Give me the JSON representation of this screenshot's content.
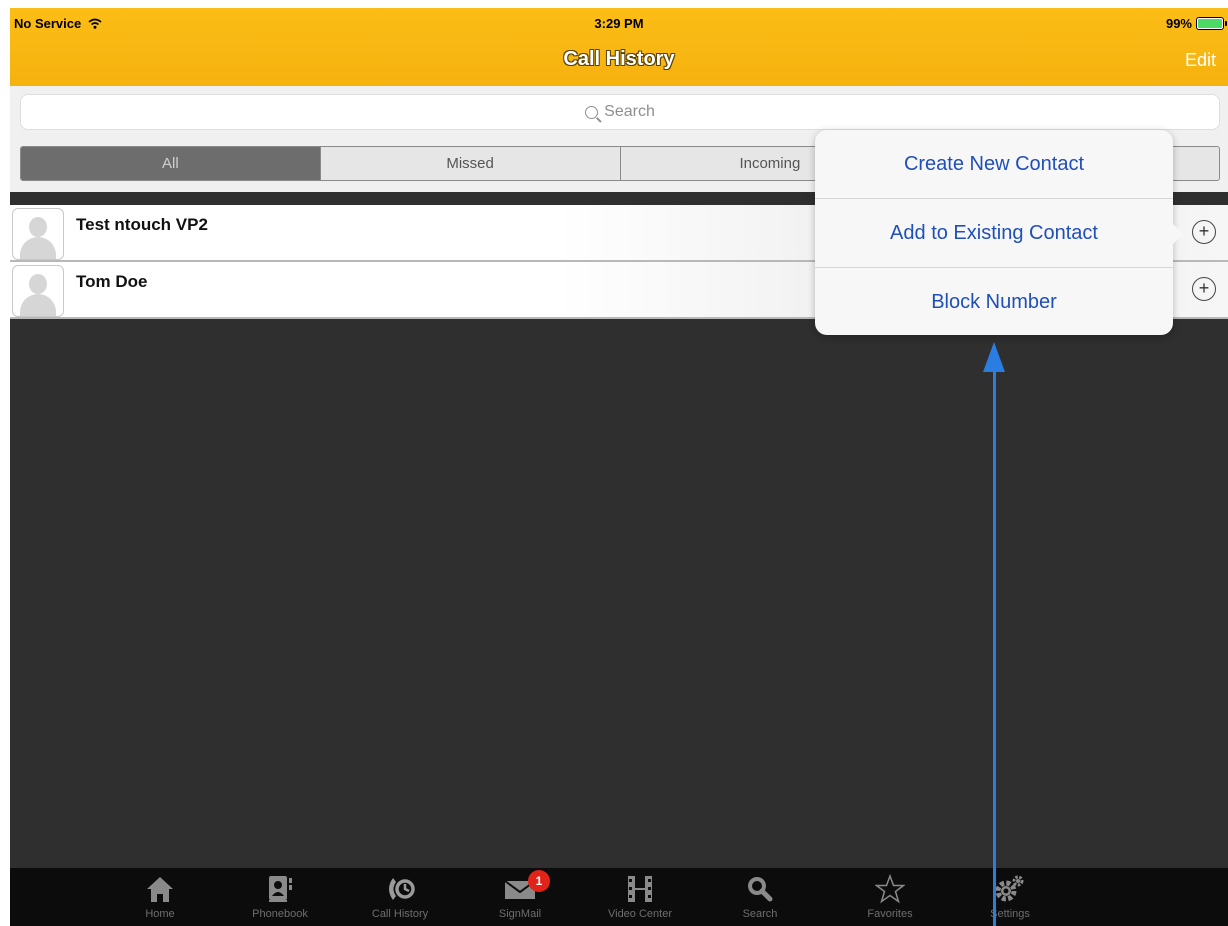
{
  "status_bar": {
    "carrier": "No Service",
    "time": "3:29 PM",
    "battery": "99%"
  },
  "nav_bar": {
    "title": "Call History",
    "edit_label": "Edit"
  },
  "search": {
    "placeholder": "Search"
  },
  "segments": [
    {
      "label": "All",
      "selected": true
    },
    {
      "label": "Missed",
      "selected": false
    },
    {
      "label": "Incoming",
      "selected": false
    },
    {
      "label": "",
      "selected": false
    }
  ],
  "calls": [
    {
      "name": "Test ntouch VP2"
    },
    {
      "name": "Tom Doe"
    }
  ],
  "popover": {
    "items": [
      {
        "label": "Create New Contact"
      },
      {
        "label": "Add to Existing Contact"
      },
      {
        "label": "Block Number"
      }
    ]
  },
  "tab_bar": {
    "tabs": [
      {
        "label": "Home",
        "icon": "home-icon"
      },
      {
        "label": "Phonebook",
        "icon": "phonebook-icon"
      },
      {
        "label": "Call History",
        "icon": "call-history-icon"
      },
      {
        "label": "SignMail",
        "icon": "signmail-icon",
        "badge": "1"
      },
      {
        "label": "Video Center",
        "icon": "film-icon"
      },
      {
        "label": "Search",
        "icon": "search-icon"
      },
      {
        "label": "Favorites",
        "icon": "star-icon"
      },
      {
        "label": "Settings",
        "icon": "gear-icon"
      }
    ]
  },
  "colors": {
    "header": "#f6b20f",
    "link": "#1f4fb8",
    "annotation_arrow": "#2a7de1",
    "badge": "#e2231a"
  }
}
